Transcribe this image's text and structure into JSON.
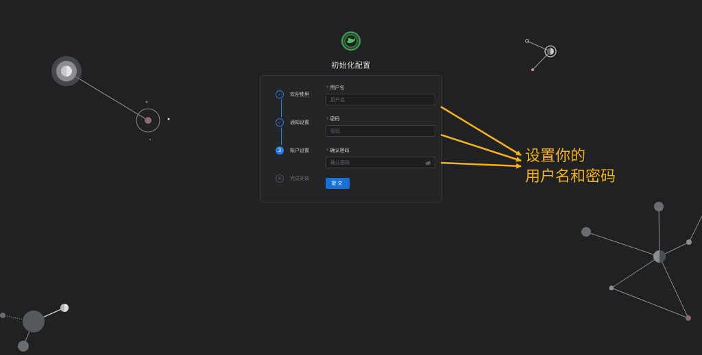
{
  "app": {
    "title": "初始化配置"
  },
  "steps": [
    {
      "label": "欢迎使用",
      "status": "done",
      "marker": "✓"
    },
    {
      "label": "通知设置",
      "status": "done",
      "marker": "✓"
    },
    {
      "label": "账户设置",
      "status": "active",
      "marker": "3"
    },
    {
      "label": "完成安装",
      "status": "todo",
      "marker": "4"
    }
  ],
  "form": {
    "username": {
      "label": "用户名",
      "placeholder": "用户名",
      "value": ""
    },
    "password": {
      "label": "密码",
      "placeholder": "密码",
      "value": ""
    },
    "confirm": {
      "label": "确认密码",
      "placeholder": "确认密码",
      "value": ""
    },
    "required_mark": "*",
    "submit_label": "提交",
    "eye_icon": "eye-off-icon"
  },
  "annotation": {
    "line1": "设置你的",
    "line2": "用户名和密码",
    "color": "#f5b21a"
  },
  "colors": {
    "background": "#1f2123",
    "card": "#232527",
    "accent": "#1670d8",
    "logo": "#3fa34d"
  }
}
